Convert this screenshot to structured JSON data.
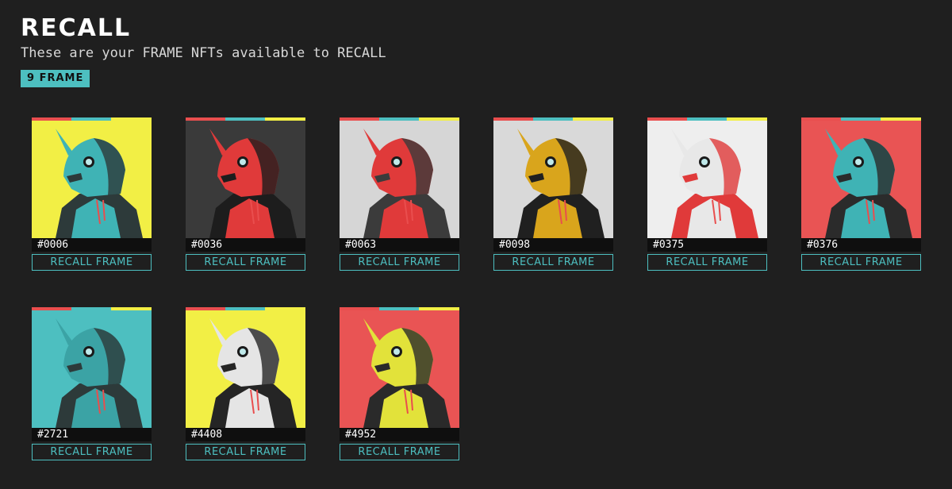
{
  "page": {
    "title": "RECALL",
    "subtitle": "These are your FRAME NFTs available to RECALL",
    "count_badge": "9 FRAME"
  },
  "colors": {
    "background": "#1f1f1f",
    "accent": "#4dbfc0",
    "stripe_red": "#e94e4e",
    "stripe_teal": "#4dbfc0",
    "stripe_yellow": "#f2ef45"
  },
  "cards": [
    {
      "id": "#0006",
      "button": "RECALL FRAME",
      "bg": "#f2ef45",
      "armor": "#3fb3b5",
      "accent": "#2d3a3a"
    },
    {
      "id": "#0036",
      "button": "RECALL FRAME",
      "bg": "#3a3a3a",
      "armor": "#e03a3a",
      "accent": "#1d1d1d"
    },
    {
      "id": "#0063",
      "button": "RECALL FRAME",
      "bg": "#d6d6d6",
      "armor": "#e03a3a",
      "accent": "#3b3b3b"
    },
    {
      "id": "#0098",
      "button": "RECALL FRAME",
      "bg": "#d9d9d9",
      "armor": "#d9a51c",
      "accent": "#202020"
    },
    {
      "id": "#0375",
      "button": "RECALL FRAME",
      "bg": "#eeeeee",
      "armor": "#e8e8e8",
      "accent": "#e03a3a"
    },
    {
      "id": "#0376",
      "button": "RECALL FRAME",
      "bg": "#e95454",
      "armor": "#3fb3b5",
      "accent": "#2b2b2b"
    },
    {
      "id": "#2721",
      "button": "RECALL FRAME",
      "bg": "#4dbfc0",
      "armor": "#3ba3a5",
      "accent": "#2d3a3a"
    },
    {
      "id": "#4408",
      "button": "RECALL FRAME",
      "bg": "#f2ef45",
      "armor": "#e5e5e5",
      "accent": "#252525"
    },
    {
      "id": "#4952",
      "button": "RECALL FRAME",
      "bg": "#e95454",
      "armor": "#e2e23a",
      "accent": "#2a2a2a"
    }
  ]
}
